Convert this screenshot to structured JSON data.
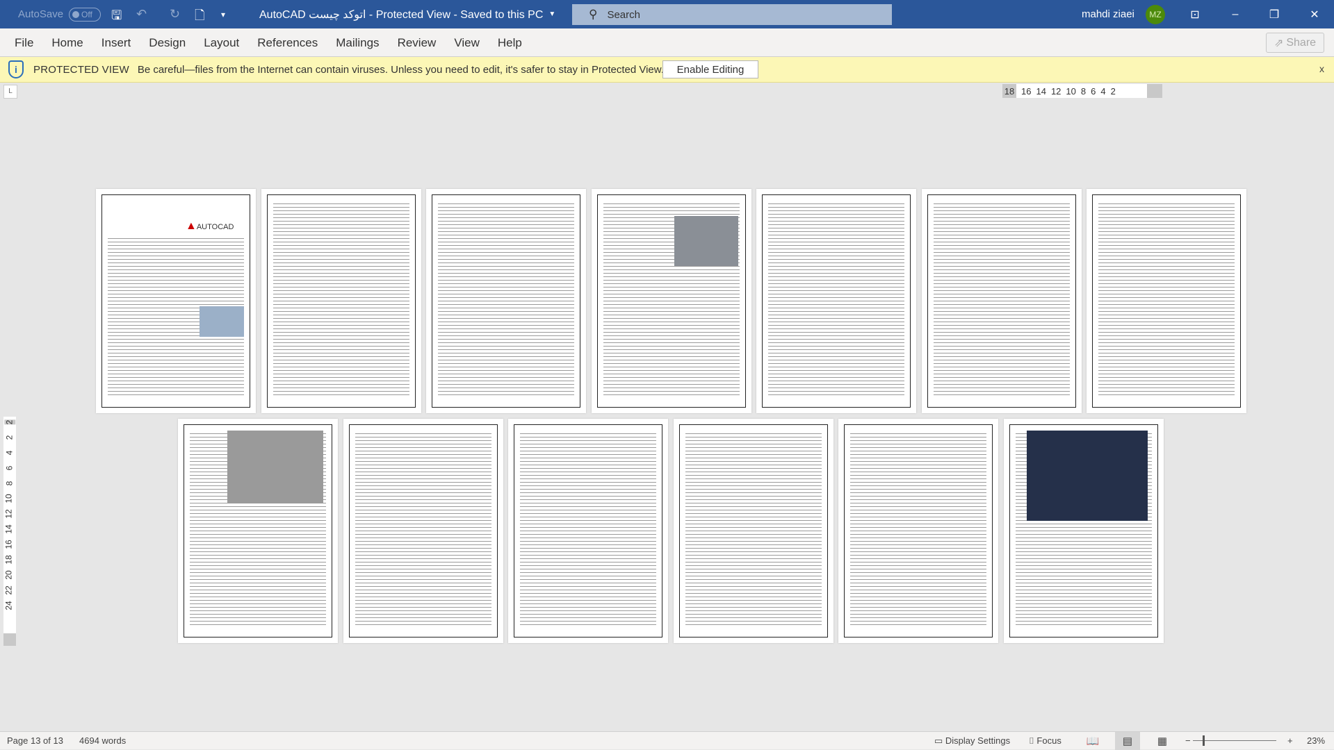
{
  "titlebar": {
    "autosave_label": "AutoSave",
    "autosave_state": "Off",
    "doc_title": "AutoCAD اتوکد چیست  -  Protected View  -  Saved to this PC",
    "search_placeholder": "Search",
    "user_name": "mahdi ziaei",
    "user_initials": "MZ"
  },
  "ribbon": {
    "tabs": [
      "File",
      "Home",
      "Insert",
      "Design",
      "Layout",
      "References",
      "Mailings",
      "Review",
      "View",
      "Help"
    ],
    "share_label": "Share"
  },
  "protected_view": {
    "title": "PROTECTED VIEW",
    "message": "Be careful—files from the Internet can contain viruses. Unless you need to edit, it's safer to stay in Protected View.",
    "enable_label": "Enable Editing",
    "close": "x"
  },
  "ruler": {
    "horizontal": [
      "18",
      "16",
      "14",
      "12",
      "10",
      "8",
      "6",
      "4",
      "2"
    ],
    "vertical": [
      "2",
      "2",
      "4",
      "6",
      "8",
      "10",
      "12",
      "14",
      "16",
      "18",
      "20",
      "22",
      "24"
    ]
  },
  "pages_row1_count": 7,
  "pages_row2_count": 6,
  "logo_text": "AUTOCAD",
  "status": {
    "page": "Page 13 of 13",
    "words": "4694 words",
    "display_settings": "Display Settings",
    "focus": "Focus",
    "zoom": "23%",
    "zoom_percent": 23
  },
  "colors": {
    "titlebar": "#2b579a",
    "protected_bar": "#fcf7b6",
    "avatar": "#4c8a0b"
  }
}
